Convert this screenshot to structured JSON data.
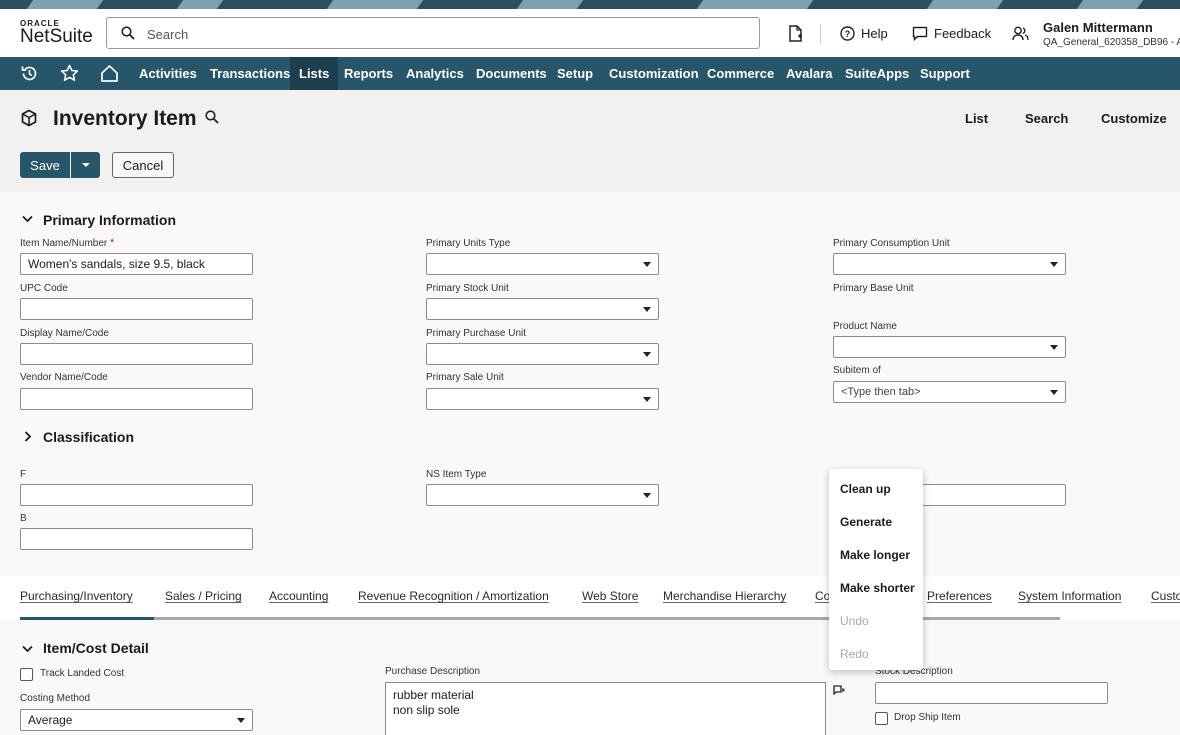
{
  "header": {
    "logo_top": "ORACLE",
    "logo_main": "NetSuite",
    "search_placeholder": "Search",
    "help_label": "Help",
    "feedback_label": "Feedback",
    "user_name": "Galen Mittermann",
    "user_role": "QA_General_620358_DB96 - A"
  },
  "nav": {
    "items": [
      "Activities",
      "Transactions",
      "Lists",
      "Reports",
      "Analytics",
      "Documents",
      "Setup",
      "Customization",
      "Commerce",
      "Avalara",
      "SuiteApps",
      "Support"
    ],
    "active": "Lists"
  },
  "page": {
    "title": "Inventory Item",
    "links": {
      "list": "List",
      "search": "Search",
      "customize": "Customize"
    },
    "save_label": "Save",
    "cancel_label": "Cancel"
  },
  "primary": {
    "section_title": "Primary Information",
    "item_name_label": "Item Name/Number",
    "required_mark": "*",
    "item_name_value": "Women's sandals, size 9.5, black",
    "upc_label": "UPC Code",
    "display_name_label": "Display Name/Code",
    "vendor_name_label": "Vendor Name/Code",
    "units_type_label": "Primary Units Type",
    "stock_unit_label": "Primary Stock Unit",
    "purchase_unit_label": "Primary Purchase Unit",
    "sale_unit_label": "Primary Sale Unit",
    "consumption_unit_label": "Primary Consumption Unit",
    "base_unit_label": "Primary Base Unit",
    "product_name_label": "Product Name",
    "subitem_label": "Subitem of",
    "subitem_value": "<Type then tab>"
  },
  "classification": {
    "section_title": "Classification",
    "f_label": "F",
    "b_label": "B",
    "ns_item_type_label": "NS Item Type"
  },
  "tabs": [
    "Purchasing/Inventory",
    "Sales / Pricing",
    "Accounting",
    "Revenue Recognition / Amortization",
    "Web Store",
    "Merchandise Hierarchy",
    "Co",
    "Preferences",
    "System Information",
    "Custo"
  ],
  "item_cost": {
    "section_title": "Item/Cost Detail",
    "track_landed_cost": "Track Landed Cost",
    "costing_method_label": "Costing Method",
    "costing_method_value": "Average",
    "purchase_desc_label": "Purchase Description",
    "purchase_desc_value": "rubber material\nnon slip sole",
    "stock_desc_label": "Stock Description",
    "drop_ship_label": "Drop Ship Item"
  },
  "popup_menu": {
    "items": [
      "Clean up",
      "Generate",
      "Make longer",
      "Make shorter",
      "Undo",
      "Redo"
    ],
    "disabled": [
      "Undo",
      "Redo"
    ]
  },
  "colors": {
    "nav_bg": "#27566b",
    "accent": "#27566b",
    "required": "#c0272d"
  }
}
